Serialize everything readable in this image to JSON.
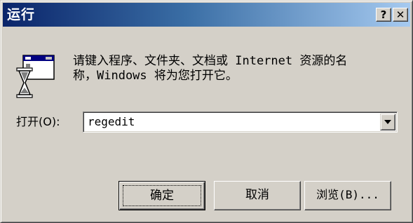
{
  "window": {
    "title": "运行",
    "help_button": "?",
    "close_button": "✕"
  },
  "dialog": {
    "description": "请键入程序、文件夹、文档或 Internet 资源的名\n称，Windows 将为您打开它。",
    "open_label": "打开(O):",
    "open_value": "regedit"
  },
  "buttons": {
    "ok": "确定",
    "cancel": "取消",
    "browse": "浏览(B)..."
  },
  "colors": {
    "face": "#d4d0c8",
    "title_start": "#0a246a",
    "title_end": "#a6caf0"
  },
  "icons": {
    "run": "run-program-icon",
    "dropdown": "chevron-down-icon"
  }
}
